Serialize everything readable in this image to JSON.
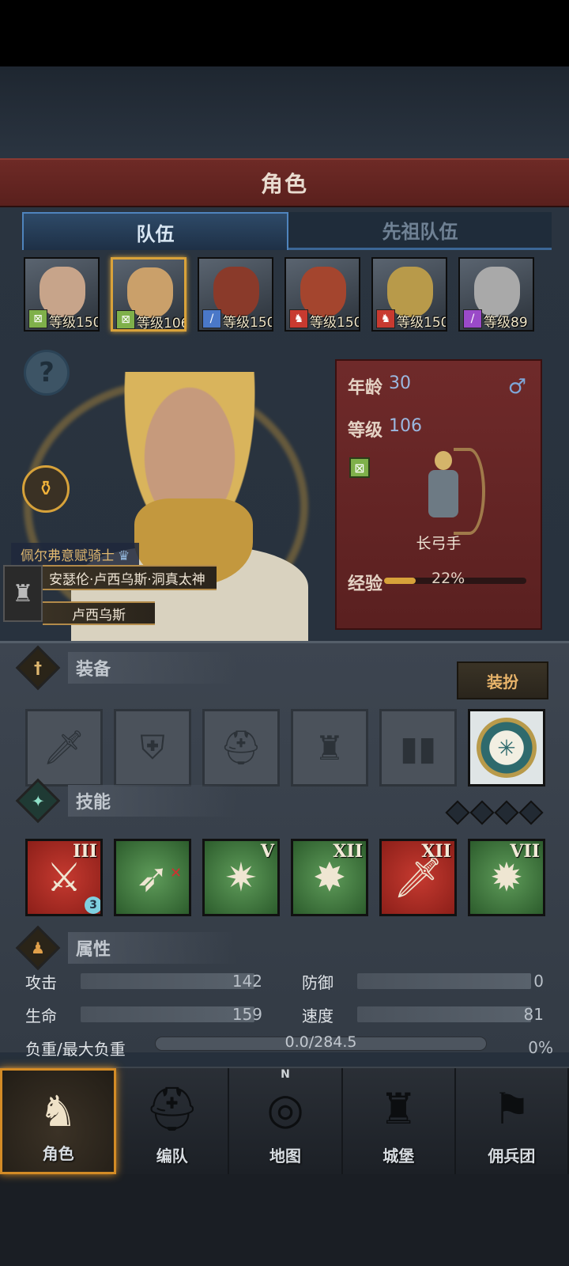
{
  "header": {
    "title": "角色"
  },
  "tabs": [
    {
      "label": "队伍",
      "active": true
    },
    {
      "label": "先祖队伍",
      "active": false
    }
  ],
  "roster": [
    {
      "level": "等级150",
      "class_color": "#7fb04a",
      "class_icon": "bow-icon"
    },
    {
      "level": "等级106",
      "class_color": "#7fb04a",
      "class_icon": "bow-icon",
      "selected": true
    },
    {
      "level": "等级150",
      "class_color": "#4a78c8",
      "class_icon": "sword-icon"
    },
    {
      "level": "等级150",
      "class_color": "#c83a30",
      "class_icon": "horse-icon"
    },
    {
      "level": "等级150",
      "class_color": "#c83a30",
      "class_icon": "horse-icon"
    },
    {
      "level": "等级89",
      "class_color": "#9a4ac8",
      "class_icon": "staff-icon"
    }
  ],
  "character": {
    "order": "佩尔弗意赋骑士",
    "full_name": "安瑟伦·卢西乌斯·洞真太神",
    "short_name": "卢西乌斯",
    "age_label": "年龄",
    "age": "30",
    "level_label": "等级",
    "level": "106",
    "gender": "♂",
    "class_name": "长弓手",
    "exp_label": "经验",
    "exp_percent": "22%",
    "exp_fraction": 0.22
  },
  "equipment": {
    "title": "装备",
    "dress_button": "装扮",
    "slots": [
      "weapon-slot",
      "shield-slot",
      "helmet-slot",
      "armor-slot",
      "boots-slot",
      "badge-slot"
    ]
  },
  "skills": {
    "title": "技能",
    "items": [
      {
        "numeral": "III",
        "color": "red",
        "count": "3"
      },
      {
        "numeral": "",
        "color": "green"
      },
      {
        "numeral": "V",
        "color": "green"
      },
      {
        "numeral": "XII",
        "color": "green"
      },
      {
        "numeral": "XII",
        "color": "red"
      },
      {
        "numeral": "VII",
        "color": "green"
      }
    ]
  },
  "attributes": {
    "title": "属性",
    "attack_label": "攻击",
    "attack": "142",
    "defense_label": "防御",
    "defense": "0",
    "hp_label": "生命",
    "hp": "159",
    "speed_label": "速度",
    "speed": "81",
    "load_label": "负重/最大负重",
    "load": "0.0/284.5",
    "load_percent": "0%"
  },
  "nav": [
    {
      "label": "角色",
      "active": true
    },
    {
      "label": "编队"
    },
    {
      "label": "地图",
      "compass": "N"
    },
    {
      "label": "城堡"
    },
    {
      "label": "佣兵团"
    }
  ]
}
